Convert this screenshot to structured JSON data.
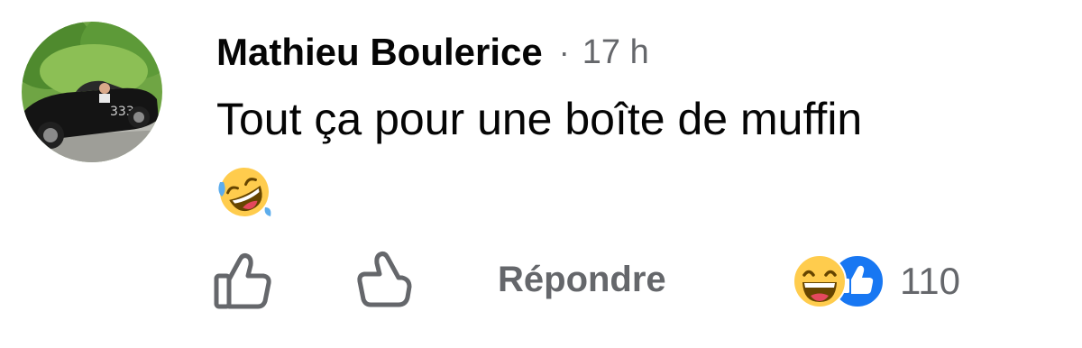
{
  "comment": {
    "author": "Mathieu Boulerice",
    "separator": "·",
    "time": "17 h",
    "text": "Tout ça pour une boîte de muffin",
    "emoji": "rolling-on-the-floor-laughing-emoji"
  },
  "actions": {
    "like_icon": "thumbs-up-outline-icon",
    "dislike_icon": "thumbs-down-outline-icon",
    "reply_label": "Répondre"
  },
  "reactions": {
    "types": [
      "haha-reaction-icon",
      "like-reaction-icon"
    ],
    "count": "110"
  },
  "colors": {
    "text_primary": "#050505",
    "text_secondary": "#65676b",
    "like_blue": "#1877f2",
    "emoji_yellow": "#ffcc4d"
  }
}
